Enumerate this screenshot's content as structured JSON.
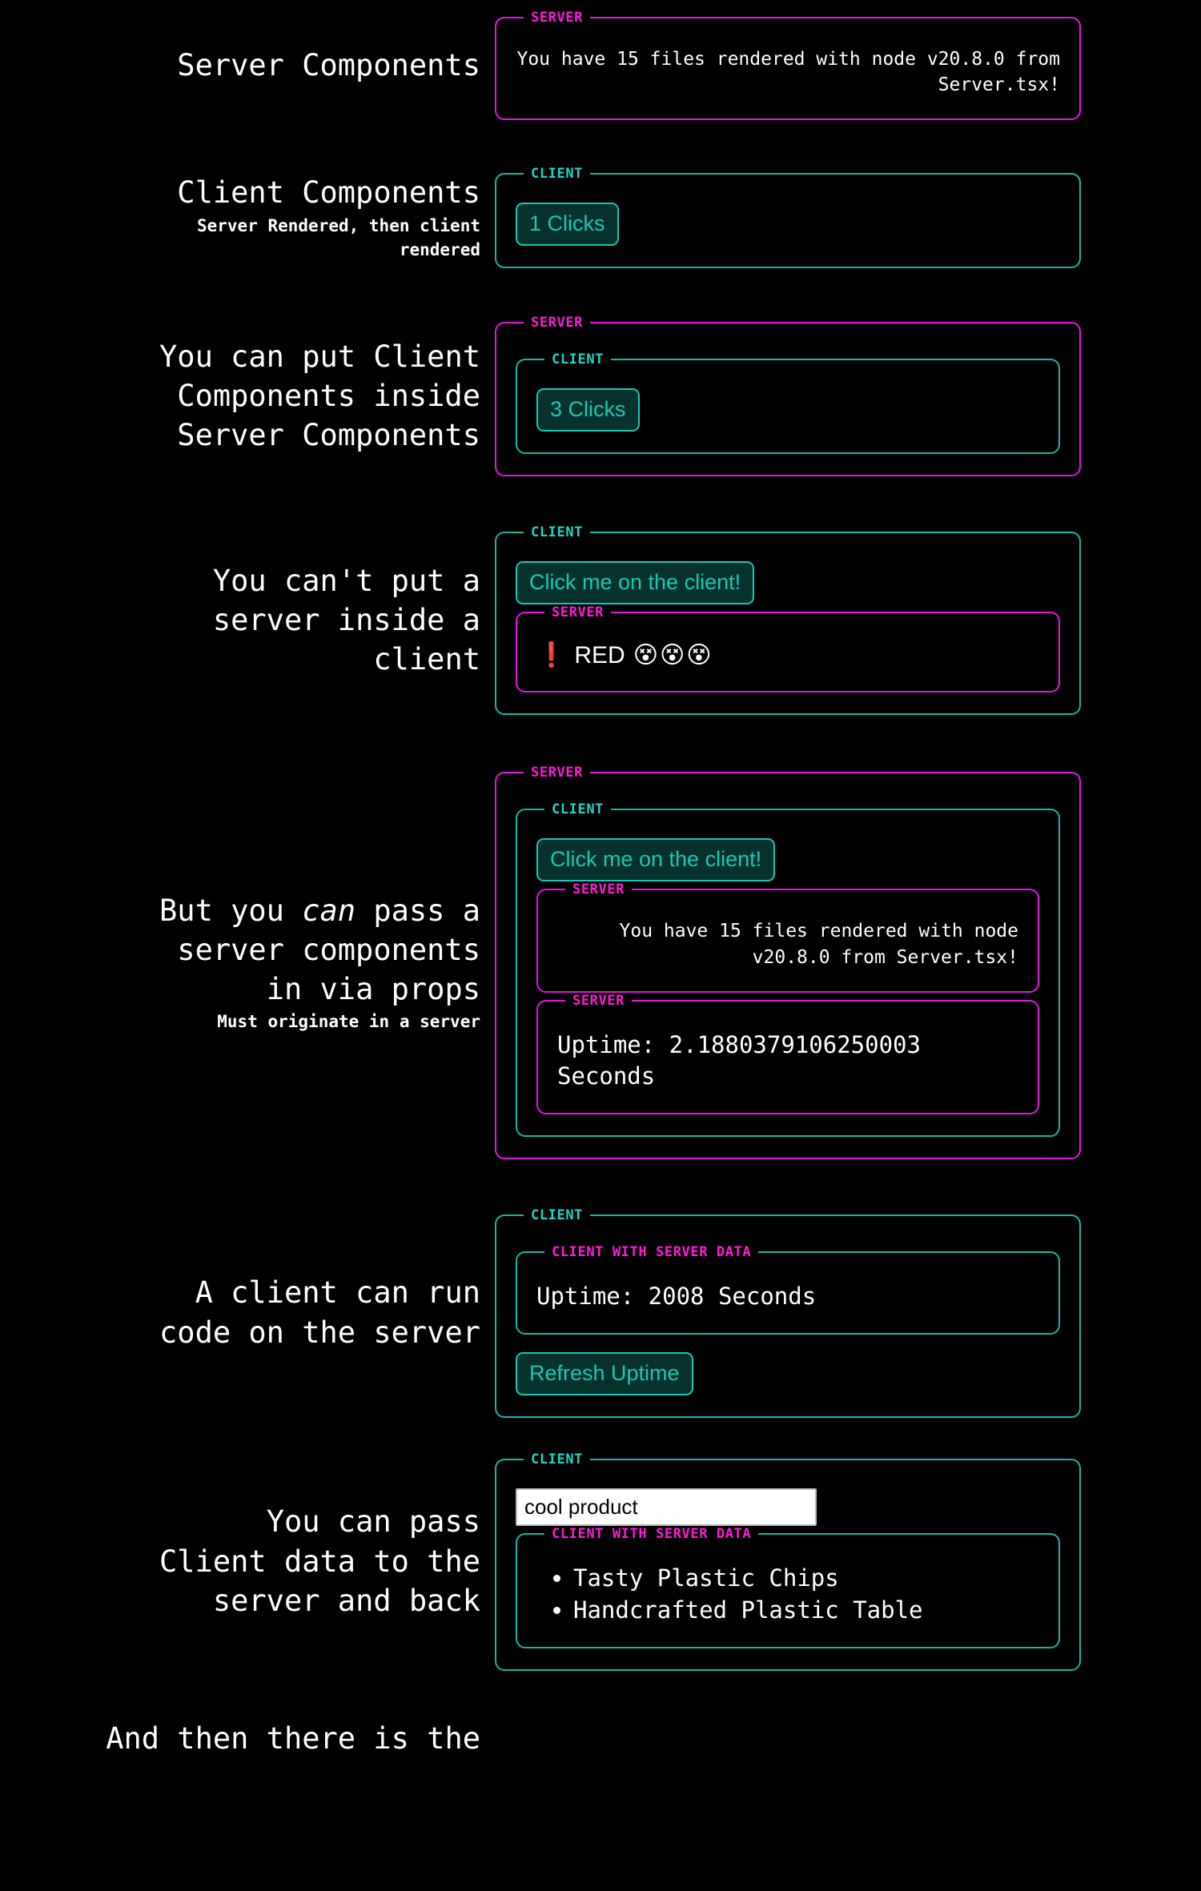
{
  "theme": {
    "background": "#000000",
    "server_color": "#e614e6",
    "server_legend_color": "#ff1ad9",
    "client_color": "#14b8a6",
    "client_legend_color": "#22d3c5",
    "button_text_color": "#19c8b4",
    "button_bg_color": "#06312c",
    "text_color": "#ffffff",
    "alert_color": "#ff2d20"
  },
  "legends": {
    "server": "SERVER",
    "client": "CLIENT",
    "client_with_server_data": "CLIENT WITH SERVER DATA"
  },
  "sections": [
    {
      "id": "server-components",
      "heading": "Server Components",
      "sub": "",
      "server_message": "You have 15 files rendered with node v20.8.0 from Server.tsx!"
    },
    {
      "id": "client-components",
      "heading": "Client Components",
      "sub_line_1": "Server Rendered, then client",
      "sub_line_2": "rendered",
      "button_label": "1 Clicks"
    },
    {
      "id": "client-inside-server",
      "heading_line_1": "You can put Client",
      "heading_line_2": "Components inside",
      "heading_line_3": "Server Components",
      "button_label": "3 Clicks"
    },
    {
      "id": "no-server-inside-client",
      "heading_line_1": "You can't put a",
      "heading_line_2": "server inside a",
      "heading_line_3": "client",
      "button_label": "Click me on the client!",
      "alert_bang": "❗",
      "alert_text": "RED",
      "alert_faces": "😵😵😵"
    },
    {
      "id": "server-via-props",
      "heading_pre": "But you ",
      "heading_em": "can",
      "heading_post": " pass a",
      "heading_line_2": "server components",
      "heading_line_3": "in via props",
      "sub": "Must originate in a server",
      "button_label": "Click me on the client!",
      "server_message": "You have 15 files rendered with node v20.8.0 from Server.tsx!",
      "uptime_text": "Uptime: 2.1880379106250003 Seconds"
    },
    {
      "id": "client-runs-server-code",
      "heading_line_1": "A client can run",
      "heading_line_2": "code on the server",
      "uptime_text": "Uptime: 2008 Seconds",
      "refresh_button_label": "Refresh Uptime"
    },
    {
      "id": "client-data-roundtrip",
      "heading_line_1": "You can pass",
      "heading_line_2": "Client data to the",
      "heading_line_3": "server and back",
      "input_value": "cool product",
      "input_placeholder": "cool product",
      "products": [
        "Tasty Plastic Chips",
        "Handcrafted Plastic Table"
      ]
    },
    {
      "id": "cut-off-footer",
      "heading_line_1": "And then there is the"
    }
  ]
}
